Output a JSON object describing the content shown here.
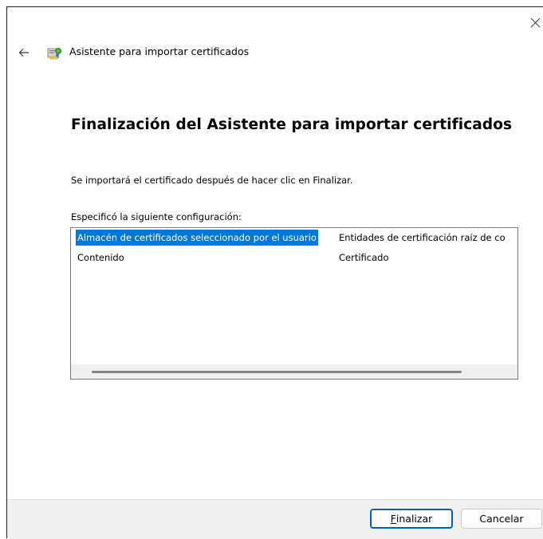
{
  "window": {
    "close_glyph": "✕"
  },
  "header": {
    "back_icon": "arrow-left-icon",
    "wizard_icon": "certificate-icon",
    "title": "Asistente para importar certificados"
  },
  "main": {
    "heading": "Finalización del Asistente para importar certificados",
    "info_text": "Se importará el certificado después de hacer clic en Finalizar.",
    "config_label": "Especificó la siguiente configuración:",
    "settings": [
      {
        "name": "Almacén de certificados seleccionado por el usuario",
        "value": "Entidades de certificación raíz de co",
        "selected": true
      },
      {
        "name": "Contenido",
        "value": "Certificado",
        "selected": false
      }
    ]
  },
  "footer": {
    "finish_first": "F",
    "finish_rest": "inalizar",
    "cancel_label": "Cancelar"
  },
  "colors": {
    "selection": "#0078d7",
    "default_button_border": "#005fb8",
    "footer_bg": "#f0f0f0"
  }
}
